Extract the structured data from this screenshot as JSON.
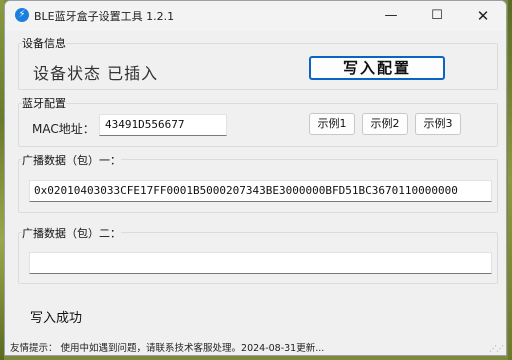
{
  "window": {
    "title": "BLE蓝牙盒子设置工具 1.2.1",
    "icon_text": "⚡",
    "minimize": "—",
    "maximize": "☐",
    "close": "✕"
  },
  "device_info": {
    "group_label": "设备信息",
    "status_text": "设备状态  已插入",
    "write_button": "写入配置"
  },
  "bluetooth": {
    "group_label": "蓝牙配置",
    "mac_label": "MAC地址：",
    "mac_value": "43491D556677",
    "examples": [
      "示例1",
      "示例2",
      "示例3"
    ]
  },
  "adv_packet_1": {
    "group_label": "广播数据（包）一：",
    "value": "0x02010403033CFE17FF0001B5000207343BE3000000BFD51BC3670110000000"
  },
  "adv_packet_2": {
    "group_label": "广播数据（包）二：",
    "value": ""
  },
  "result_text": "写入成功",
  "footer": {
    "tips": "友情提示：  使用中如遇到问题，请联系技术客服处理。2024-08-31更新...",
    "grip": "⋰⋰"
  }
}
